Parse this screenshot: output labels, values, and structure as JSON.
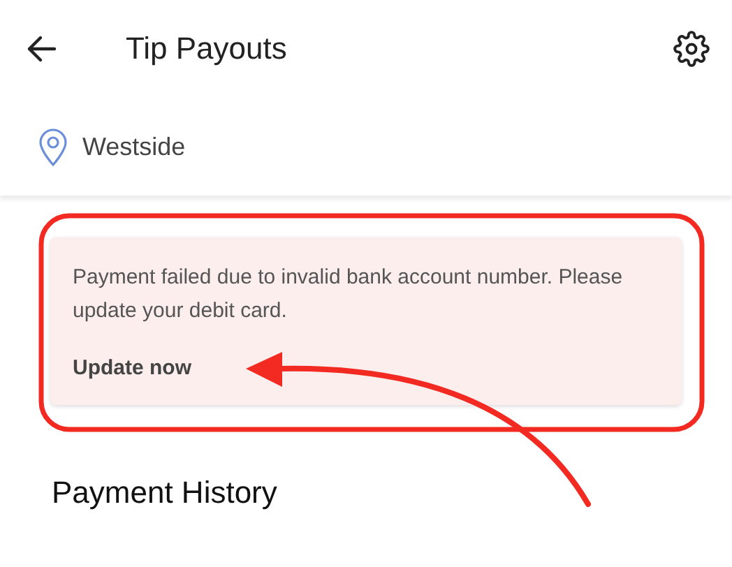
{
  "header": {
    "title": "Tip Payouts"
  },
  "location": {
    "name": "Westside"
  },
  "alert": {
    "message": "Payment failed due to invalid bank account number. Please update your debit card.",
    "action": "Update now"
  },
  "section": {
    "title": "Payment History"
  }
}
